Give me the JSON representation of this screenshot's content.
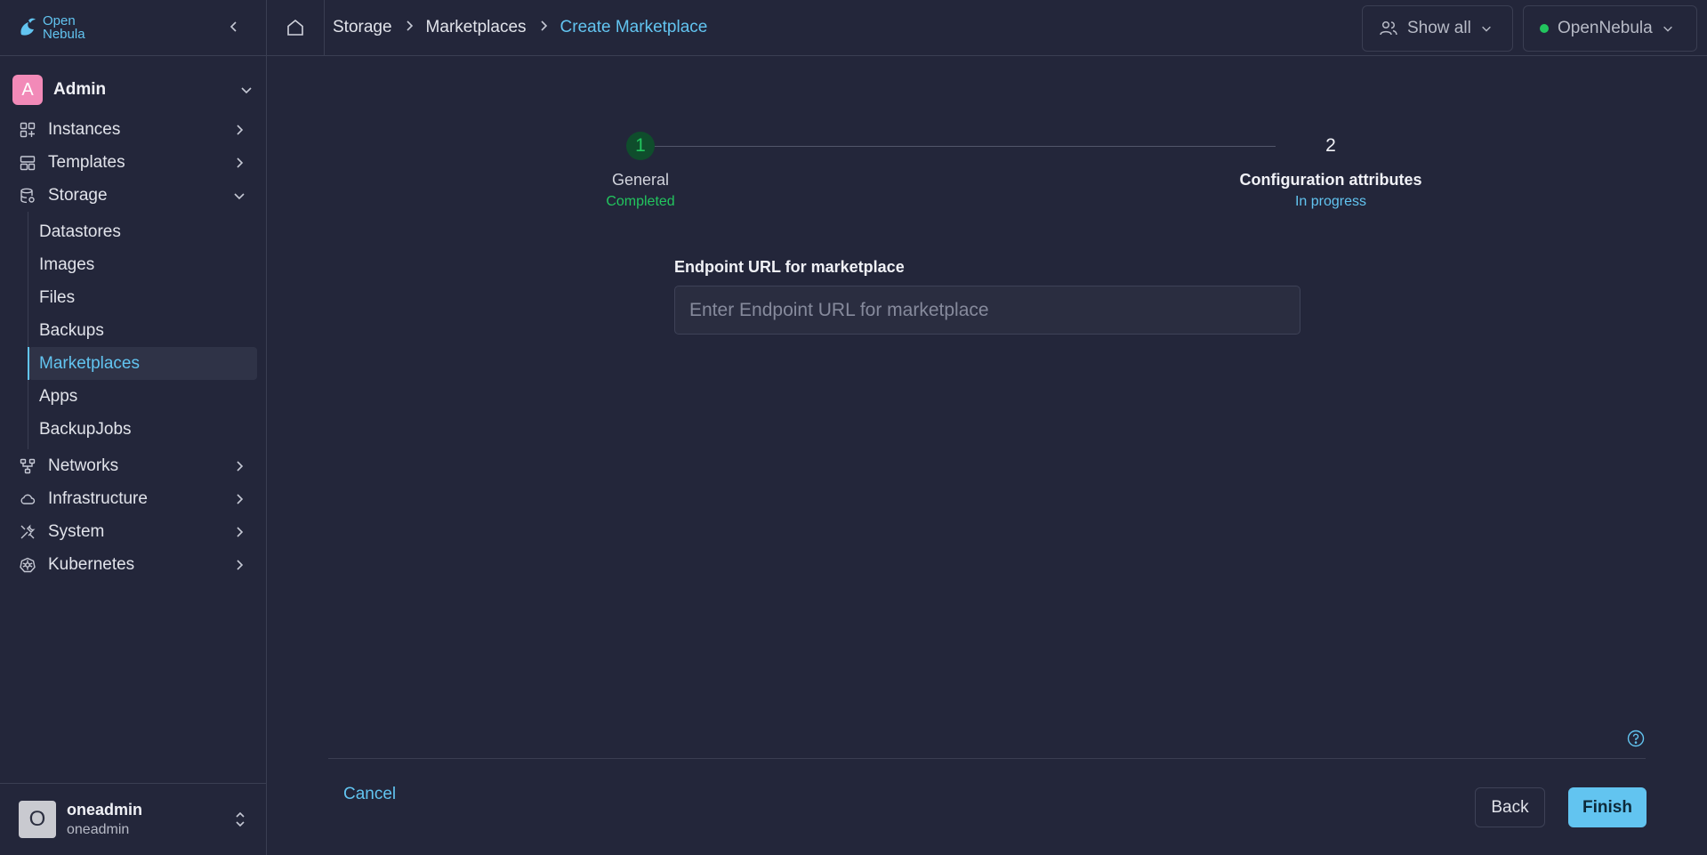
{
  "app": {
    "logo_line1": "Open",
    "logo_line2": "Nebula"
  },
  "sidebar": {
    "group": {
      "initial": "A",
      "name": "Admin"
    },
    "items": [
      {
        "label": "Instances",
        "icon": "grid-plus-icon"
      },
      {
        "label": "Templates",
        "icon": "layout-icon"
      },
      {
        "label": "Storage",
        "icon": "database-icon",
        "expanded": true
      }
    ],
    "storage_children": [
      {
        "label": "Datastores"
      },
      {
        "label": "Images"
      },
      {
        "label": "Files"
      },
      {
        "label": "Backups"
      },
      {
        "label": "Marketplaces",
        "active": true
      },
      {
        "label": "Apps"
      },
      {
        "label": "BackupJobs"
      }
    ],
    "items_after": [
      {
        "label": "Networks",
        "icon": "network-icon"
      },
      {
        "label": "Infrastructure",
        "icon": "cloud-icon"
      },
      {
        "label": "System",
        "icon": "tools-icon"
      },
      {
        "label": "Kubernetes",
        "icon": "kubernetes-icon"
      }
    ],
    "user": {
      "initial": "O",
      "name": "oneadmin",
      "sub": "oneadmin"
    }
  },
  "topbar": {
    "breadcrumbs": [
      "Storage",
      "Marketplaces",
      "Create Marketplace"
    ],
    "show_all_label": "Show all",
    "zone_label": "OpenNebula"
  },
  "stepper": {
    "steps": [
      {
        "number": "1",
        "title": "General",
        "status": "Completed"
      },
      {
        "number": "2",
        "title": "Configuration attributes",
        "status": "In progress"
      }
    ]
  },
  "form": {
    "endpoint_label": "Endpoint URL for marketplace",
    "endpoint_placeholder": "Enter Endpoint URL for marketplace",
    "endpoint_value": ""
  },
  "footer": {
    "cancel_label": "Cancel",
    "back_label": "Back",
    "finish_label": "Finish"
  },
  "colors": {
    "accent": "#62c4f0",
    "background": "#23263a",
    "success": "#22c55e",
    "group_avatar": "#f28ab8"
  }
}
